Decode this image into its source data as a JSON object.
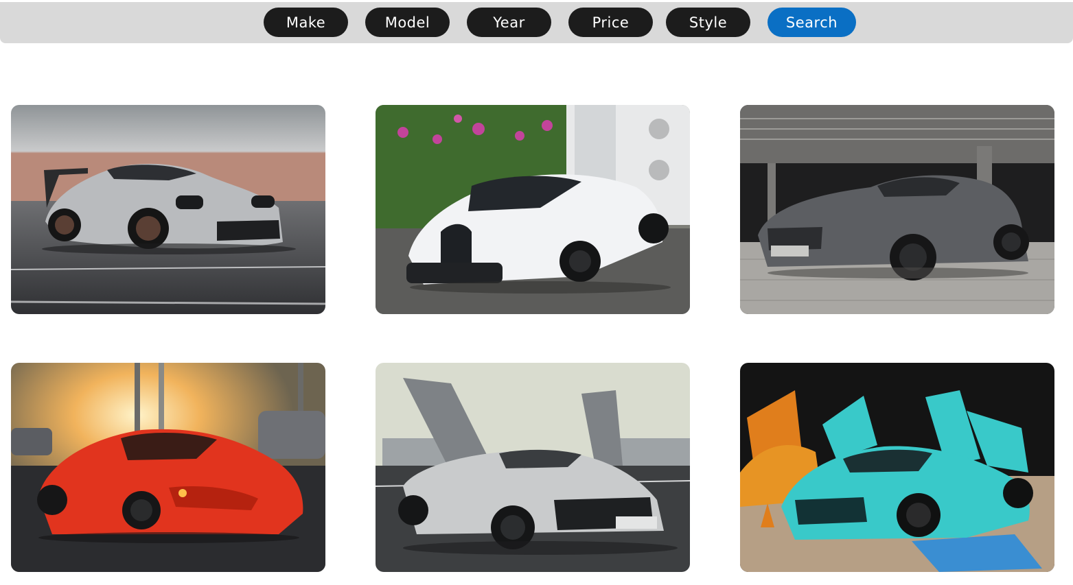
{
  "filters": {
    "make_label": "Make",
    "model_label": "Model",
    "year_label": "Year",
    "price_label": "Price",
    "style_label": "Style",
    "search_label": "Search"
  },
  "colors": {
    "bar_background": "#d9d9d9",
    "pill_background": "#1c1c1c",
    "search_accent": "#0a6fc4"
  },
  "gallery": {
    "cards": [
      {
        "subject": "silver-sports-car",
        "car_color": "#b9bbbe"
      },
      {
        "subject": "white-hypercar",
        "car_color": "#f2f3f5"
      },
      {
        "subject": "grey-grand-tourer",
        "car_color": "#5c5e62"
      },
      {
        "subject": "red-sports-car",
        "car_color": "#e1341e"
      },
      {
        "subject": "silver-supercar-doors-open",
        "car_color": "#c9cbcc"
      },
      {
        "subject": "teal-supercar-doors-open",
        "car_color": "#39c9c9"
      }
    ]
  }
}
